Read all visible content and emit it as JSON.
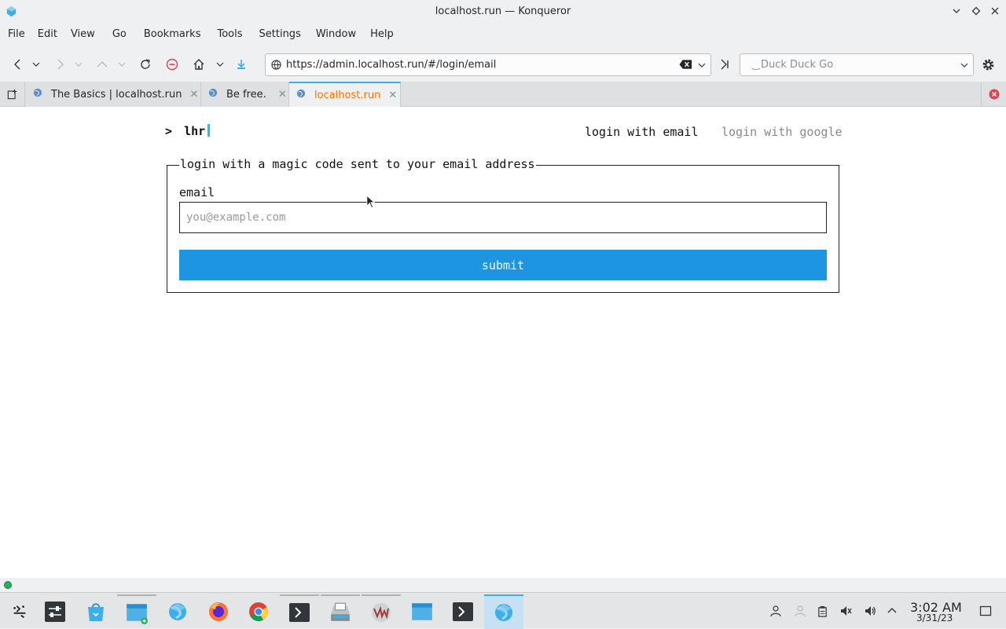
{
  "window": {
    "title": "localhost.run — Konqueror",
    "controls": [
      "minimize",
      "maximize",
      "close"
    ]
  },
  "menubar": {
    "items": [
      "File",
      "Edit",
      "View",
      "Go",
      "Bookmarks",
      "Tools",
      "Settings",
      "Window",
      "Help"
    ]
  },
  "toolbar": {
    "url": "https://admin.localhost.run/#/login/email",
    "search_placeholder": "Duck Duck Go"
  },
  "tabs": [
    {
      "label": "The Basics | localhost.run",
      "active": false
    },
    {
      "label": "Be free.",
      "active": false
    },
    {
      "label": "localhost.run",
      "active": true
    }
  ],
  "page": {
    "logo_prompt": ">",
    "logo_text": "lhr",
    "nav": {
      "email": "login with email",
      "google": "login with google"
    },
    "form": {
      "legend": "login with a magic code sent to your email address",
      "email_label": "email",
      "email_placeholder": "you@example.com",
      "email_value": "",
      "submit_label": "submit"
    }
  },
  "taskbar": {
    "apps": [
      "application-launcher",
      "system-settings",
      "discover",
      "dolphin-file-manager",
      "konqueror",
      "firefox",
      "chrome",
      "terminal",
      "scanner",
      "virt-manager",
      "files",
      "terminal-2",
      "konqueror-active"
    ],
    "clock_time": "3:02 AM",
    "clock_date": "3/31/23"
  },
  "colors": {
    "accent": "#3daee9",
    "submit_bg": "#1e95e0",
    "active_tab_text": "#f67400"
  }
}
